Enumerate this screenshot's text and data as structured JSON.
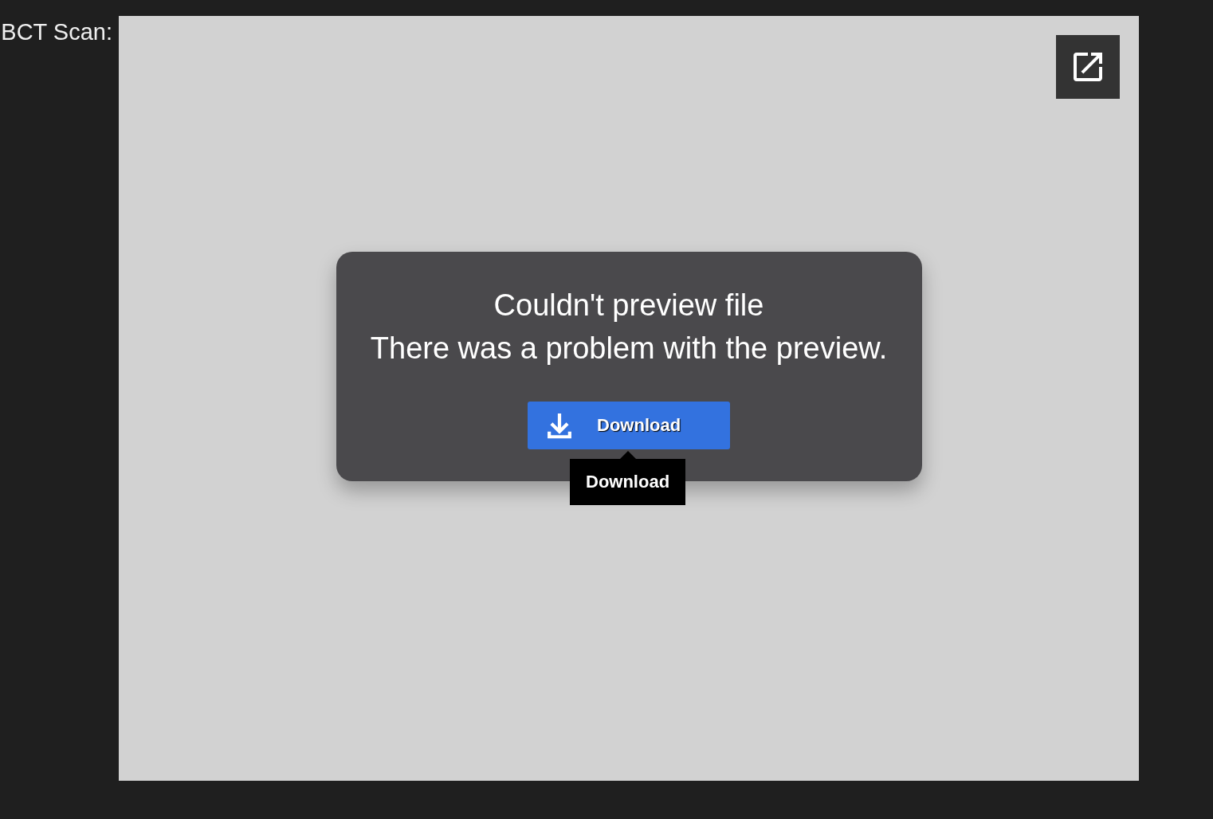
{
  "label": "BCT Scan:",
  "preview": {
    "dialog": {
      "title": "Couldn't preview file",
      "message": "There was a problem with the preview.",
      "button": "Download",
      "tooltip": "Download"
    }
  }
}
